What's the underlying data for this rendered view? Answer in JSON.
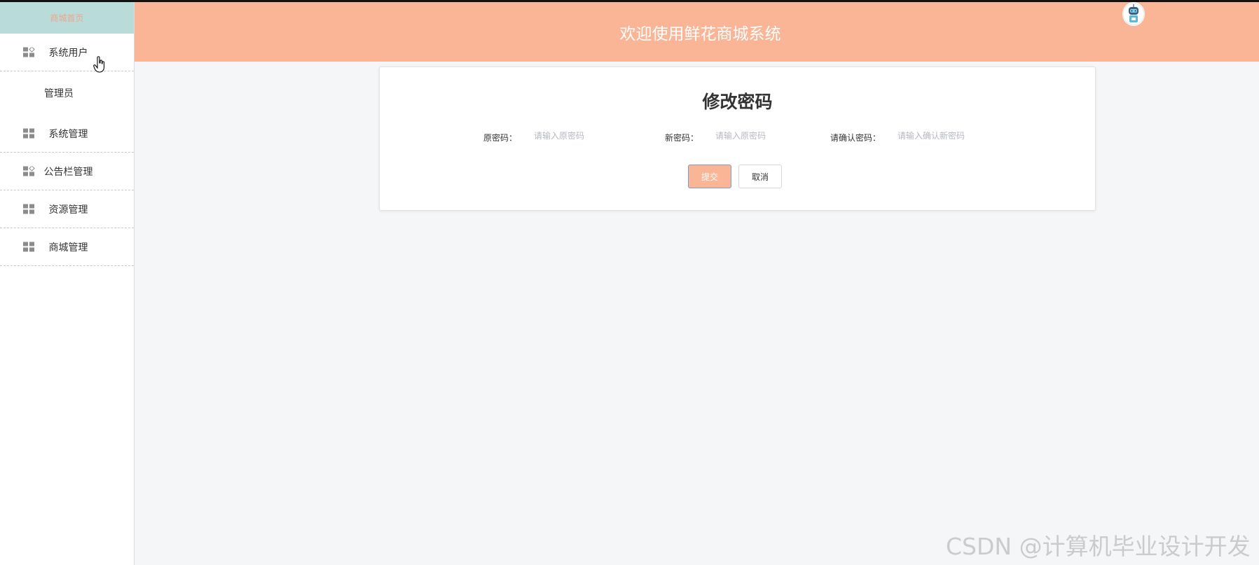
{
  "sidebar": {
    "top_text": "商城首页",
    "items": [
      {
        "label": "系统用户",
        "icon": "grid-icon"
      },
      {
        "label": "系统管理",
        "icon": "grid-icon"
      },
      {
        "label": "公告栏管理",
        "icon": "grid-icon"
      },
      {
        "label": "资源管理",
        "icon": "grid-icon"
      },
      {
        "label": "商城管理",
        "icon": "grid-icon"
      }
    ],
    "submenu": [
      "管理员"
    ]
  },
  "header": {
    "title": "欢迎使用鲜花商城系统",
    "avatar_icon": "robot-avatar-icon"
  },
  "form": {
    "title": "修改密码",
    "old_password": {
      "label": "原密码：",
      "placeholder": "请输入原密码"
    },
    "new_password": {
      "label": "新密码：",
      "placeholder": "请输入原密码"
    },
    "confirm_password": {
      "label": "请确认密码：",
      "placeholder": "请输入确认新密码"
    },
    "submit_label": "提交",
    "cancel_label": "取消"
  },
  "watermark": "CSDN @计算机毕业设计开发",
  "colors": {
    "header_bg": "#f9b595",
    "sidebar_top_bg": "#b9dcdb",
    "submit_bg": "#f9b595",
    "page_bg": "#f5f6f8"
  }
}
